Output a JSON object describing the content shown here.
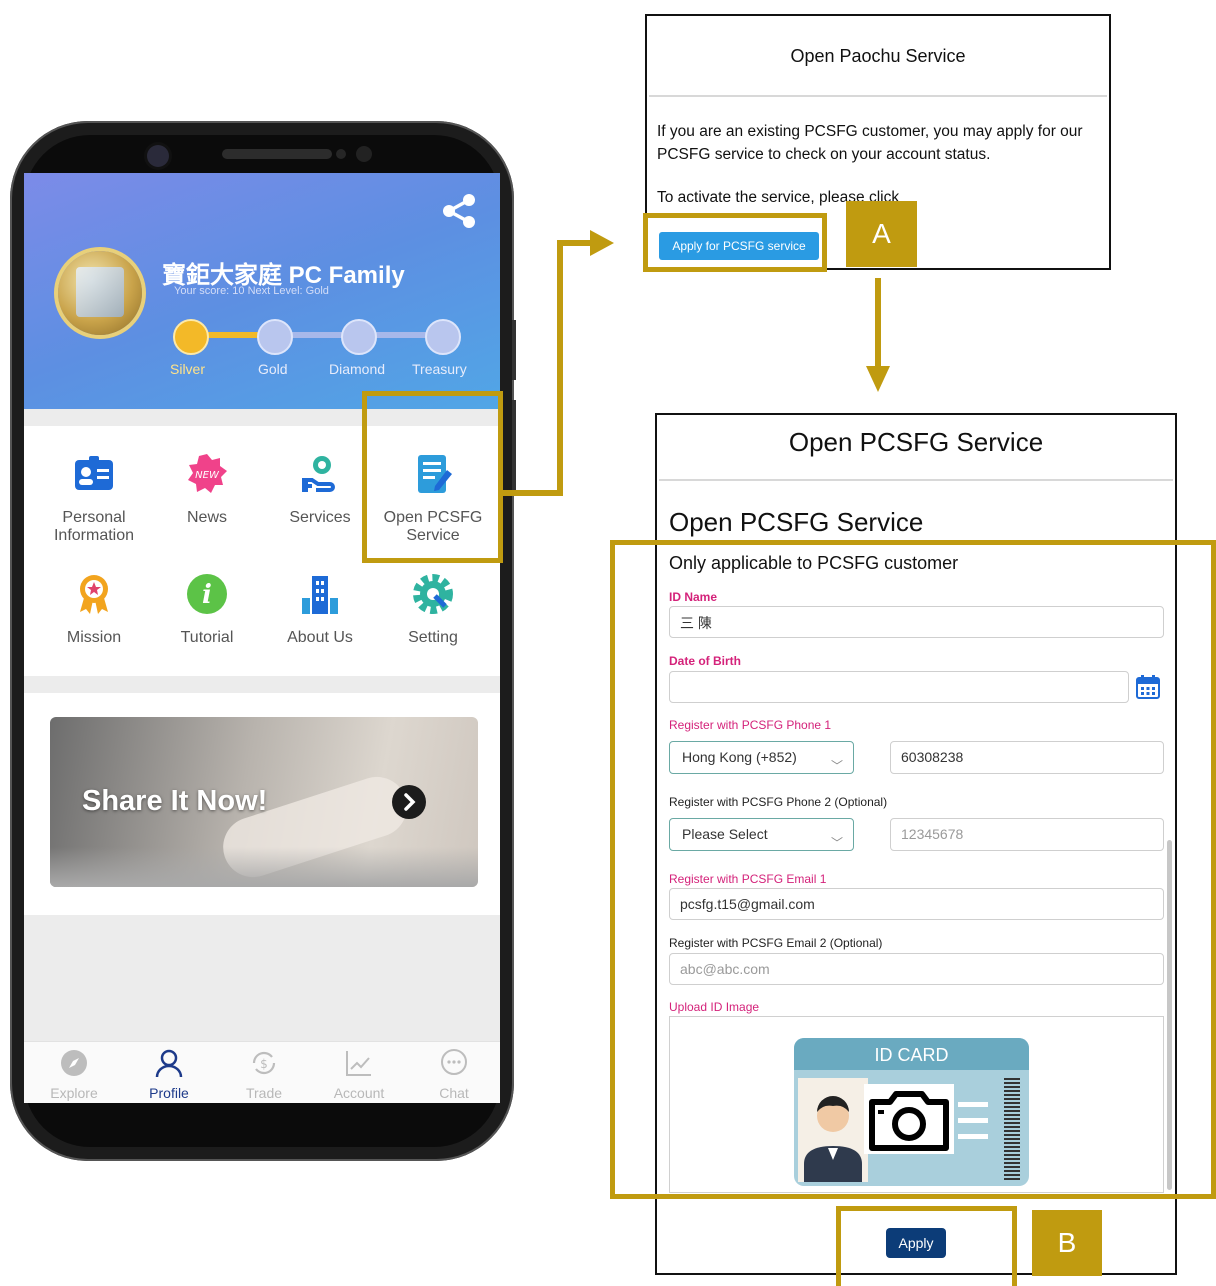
{
  "phone": {
    "header": {
      "title": "寶鉅大家庭 PC Family",
      "score_line": "Your score: 10   Next Level: Gold",
      "levels": [
        {
          "label": "Silver",
          "active": true
        },
        {
          "label": "Gold",
          "active": false
        },
        {
          "label": "Diamond",
          "active": false
        },
        {
          "label": "Treasury",
          "active": false
        }
      ]
    },
    "menu": [
      {
        "label": "Personal Information",
        "icon": "id-card-icon"
      },
      {
        "label": "News",
        "icon": "news-badge-icon"
      },
      {
        "label": "Services",
        "icon": "services-hand-gear-icon"
      },
      {
        "label": "Open PCSFG Service",
        "icon": "document-pen-icon"
      },
      {
        "label": "Mission",
        "icon": "medal-icon"
      },
      {
        "label": "Tutorial",
        "icon": "info-icon"
      },
      {
        "label": "About Us",
        "icon": "building-icon"
      },
      {
        "label": "Setting",
        "icon": "settings-gear-icon"
      }
    ],
    "news_badge": "NEW",
    "banner": {
      "text": "Share It Now!"
    },
    "tabs": [
      {
        "label": "Explore",
        "icon": "compass-icon",
        "active": false
      },
      {
        "label": "Profile",
        "icon": "person-icon",
        "active": true
      },
      {
        "label": "Trade",
        "icon": "exchange-dollar-icon",
        "active": false
      },
      {
        "label": "Account",
        "icon": "chart-line-icon",
        "active": false
      },
      {
        "label": "Chat",
        "icon": "chat-bubble-icon",
        "active": false
      }
    ]
  },
  "dialog1": {
    "title": "Open Paochu Service",
    "body_p1": "If you are an existing PCSFG customer,  you may apply for our PCSFG service to check on your account status.",
    "body_p2": "To activate the service, please click",
    "button": "Apply for PCSFG service",
    "tag": "A"
  },
  "dialog2": {
    "title": "Open PCSFG Service",
    "heading": "Open PCSFG Service",
    "subtitle": "Only applicable to PCSFG customer",
    "fields": {
      "id_name": {
        "label": "ID Name",
        "value": "三 陳"
      },
      "dob": {
        "label": "Date of Birth",
        "value": ""
      },
      "phone1": {
        "label": "Register with PCSFG Phone 1",
        "country": "Hong Kong (+852)",
        "number": "60308238"
      },
      "phone2": {
        "label": "Register with PCSFG Phone 2 (Optional)",
        "country": "Please Select",
        "placeholder": "12345678"
      },
      "email1": {
        "label": "Register with PCSFG Email 1",
        "value": "pcsfg.t15@gmail.com"
      },
      "email2": {
        "label": "Register with PCSFG Email 2 (Optional)",
        "placeholder": "abc@abc.com"
      },
      "upload": {
        "label": "Upload ID Image",
        "card_title": "ID CARD"
      }
    },
    "button": "Apply",
    "tag": "B"
  },
  "colors": {
    "annotation_gold": "#c09b10",
    "header_blue": "#5d8fe2",
    "required_pink": "#d4227a",
    "apply_navy": "#0c3c78",
    "apply_pc_blue": "#2a9be3"
  }
}
